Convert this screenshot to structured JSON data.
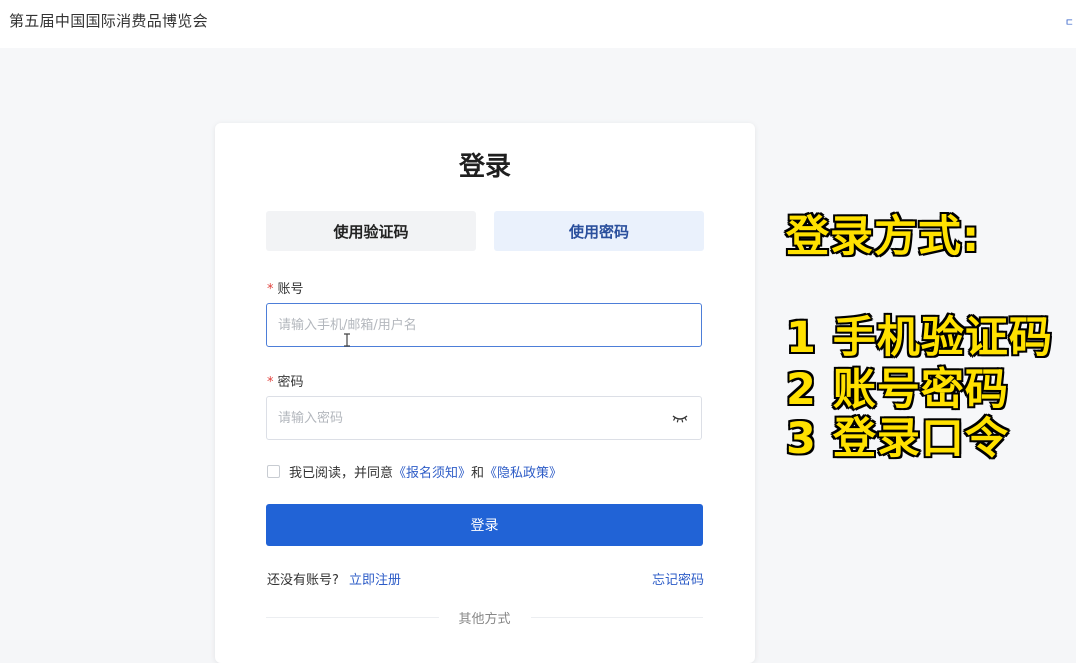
{
  "header": {
    "site_title": "第五届中国国际消费品博览会",
    "corner_mark": "ㄷ"
  },
  "login": {
    "title": "登录",
    "tabs": [
      {
        "label": "使用验证码",
        "active": false
      },
      {
        "label": "使用密码",
        "active": true
      }
    ],
    "account": {
      "label": "账号",
      "required_mark": "*",
      "placeholder": "请输入手机/邮箱/用户名",
      "value": ""
    },
    "password": {
      "label": "密码",
      "required_mark": "*",
      "placeholder": "请输入密码",
      "value": ""
    },
    "agreement": {
      "prefix": "我已阅读，并同意",
      "link1": "《报名须知》",
      "middle": "和",
      "link2": "《隐私政策》",
      "checked": false
    },
    "submit_label": "登录",
    "no_account_text": "还没有账号?",
    "register_link": "立即注册",
    "forgot_link": "忘记密码",
    "other_methods": "其他方式"
  },
  "overlay": {
    "heading": "登录方式:",
    "items": [
      "1 手机验证码",
      "2 账号密码",
      "3 登录口令"
    ],
    "text_color": "#ffe100",
    "outline_color": "#111111"
  },
  "colors": {
    "primary": "#2163d6",
    "link": "#2d5cc7",
    "required": "#e0413c"
  }
}
